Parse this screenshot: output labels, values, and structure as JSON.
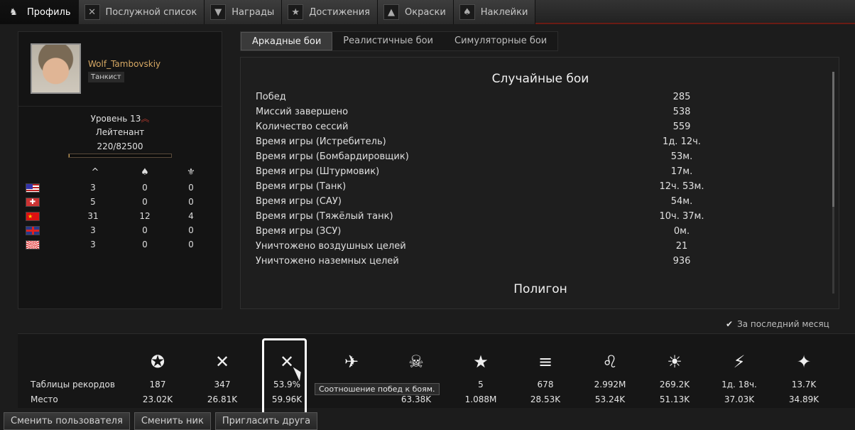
{
  "tabs": [
    {
      "label": "Профиль",
      "icon": "profile-icon",
      "glyph": "♞"
    },
    {
      "label": "Послужной список",
      "icon": "service-record-icon",
      "glyph": "✕"
    },
    {
      "label": "Награды",
      "icon": "awards-icon",
      "glyph": "▼"
    },
    {
      "label": "Достижения",
      "icon": "achievements-icon",
      "glyph": "★"
    },
    {
      "label": "Окраски",
      "icon": "camouflage-icon",
      "glyph": "▲"
    },
    {
      "label": "Наклейки",
      "icon": "decals-icon",
      "glyph": "♠"
    }
  ],
  "profile": {
    "nick": "Wolf_Tambovskiy",
    "title_badge": "Танкист",
    "level": "Уровень 13",
    "rank": "Лейтенант",
    "xp": "220/82500",
    "xp_fraction": 0.003,
    "stat_headers": [
      "^",
      "♠",
      "⚜"
    ],
    "nations": [
      {
        "flag": "usa-flag",
        "values": [
          "3",
          "0",
          "0"
        ]
      },
      {
        "flag": "germany-flag",
        "values": [
          "5",
          "0",
          "0"
        ]
      },
      {
        "flag": "ussr-flag",
        "values": [
          "31",
          "12",
          "4"
        ]
      },
      {
        "flag": "uk-flag",
        "values": [
          "3",
          "0",
          "0"
        ]
      },
      {
        "flag": "japan-flag",
        "values": [
          "3",
          "0",
          "0"
        ]
      }
    ]
  },
  "modes": [
    "Аркадные бои",
    "Реалистичные бои",
    "Симуляторные бои"
  ],
  "stats": {
    "section_title": "Случайные бои",
    "rows": [
      {
        "label": "Побед",
        "value": "285"
      },
      {
        "label": "Миссий завершено",
        "value": "538"
      },
      {
        "label": "Количество сессий",
        "value": "559"
      },
      {
        "label": "Время игры (Истребитель)",
        "value": "1д. 12ч."
      },
      {
        "label": "Время игры (Бомбардировщик)",
        "value": "53м."
      },
      {
        "label": "Время игры (Штурмовик)",
        "value": "17м."
      },
      {
        "label": "Время игры (Танк)",
        "value": "12ч. 53м."
      },
      {
        "label": "Время игры (САУ)",
        "value": "54м."
      },
      {
        "label": "Время игры (Тяжёлый танк)",
        "value": "10ч. 37м."
      },
      {
        "label": "Время игры (ЗСУ)",
        "value": "0м."
      },
      {
        "label": "Уничтожено воздушных целей",
        "value": "21"
      },
      {
        "label": "Уничтожено наземных целей",
        "value": "936"
      }
    ],
    "next_section": "Полигон"
  },
  "last_month": "За последний месяц",
  "board": {
    "row1_label": "Таблицы рекордов",
    "row2_label": "Место",
    "columns": [
      {
        "icon": "victories-icon",
        "glyph": "✪",
        "value": "187",
        "place": "23.02K"
      },
      {
        "icon": "battles-icon",
        "glyph": "✕",
        "value": "347",
        "place": "26.81K"
      },
      {
        "icon": "win-ratio-icon",
        "glyph": "✕",
        "value": "53.9%",
        "place": "59.96K"
      },
      {
        "icon": "aircraft-icon",
        "glyph": "✈",
        "value": "",
        "place": ""
      },
      {
        "icon": "skull-icon",
        "glyph": "☠",
        "value": "",
        "place": "63.38K"
      },
      {
        "icon": "stars-icon",
        "glyph": "★",
        "value": "5",
        "place": "1.088M"
      },
      {
        "icon": "ground-units-icon",
        "glyph": "≡",
        "value": "678",
        "place": "28.53K"
      },
      {
        "icon": "lion-icon",
        "glyph": "♌",
        "value": "2.992M",
        "place": "53.24K"
      },
      {
        "icon": "bulb-icon",
        "glyph": "☀",
        "value": "269.2K",
        "place": "51.13K"
      },
      {
        "icon": "time-icon",
        "glyph": "⚡",
        "value": "1д. 18ч.",
        "place": "37.03K"
      },
      {
        "icon": "rating-icon",
        "glyph": "✦",
        "value": "13.7K",
        "place": "34.89K"
      }
    ],
    "tooltip": "Соотношение побед к боям."
  },
  "buttons": [
    "Сменить пользователя",
    "Сменить ник",
    "Пригласить друга"
  ]
}
